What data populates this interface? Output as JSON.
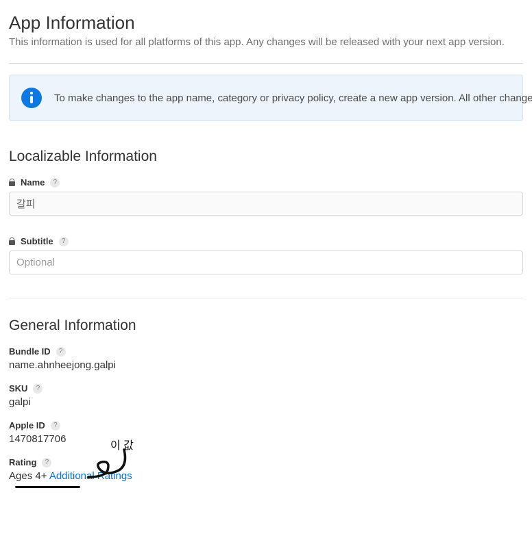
{
  "header": {
    "title": "App Information",
    "subtitle": "This information is used for all platforms of this app. Any changes will be released with your next app version."
  },
  "banner": {
    "text": "To make changes to the app name, category or privacy policy, create a new app version. All other changes"
  },
  "localizable": {
    "section_title": "Localizable Information",
    "name_label": "Name",
    "name_value": "갈피",
    "subtitle_label": "Subtitle",
    "subtitle_placeholder": "Optional",
    "subtitle_value": ""
  },
  "general": {
    "section_title": "General Information",
    "bundle_id_label": "Bundle ID",
    "bundle_id_value": "name.ahnheejong.galpi",
    "sku_label": "SKU",
    "sku_value": "galpi",
    "apple_id_label": "Apple ID",
    "apple_id_value": "1470817706",
    "rating_label": "Rating",
    "rating_value": "Ages 4+",
    "rating_link": "Additional Ratings"
  },
  "annotation": {
    "text": "이 값"
  }
}
